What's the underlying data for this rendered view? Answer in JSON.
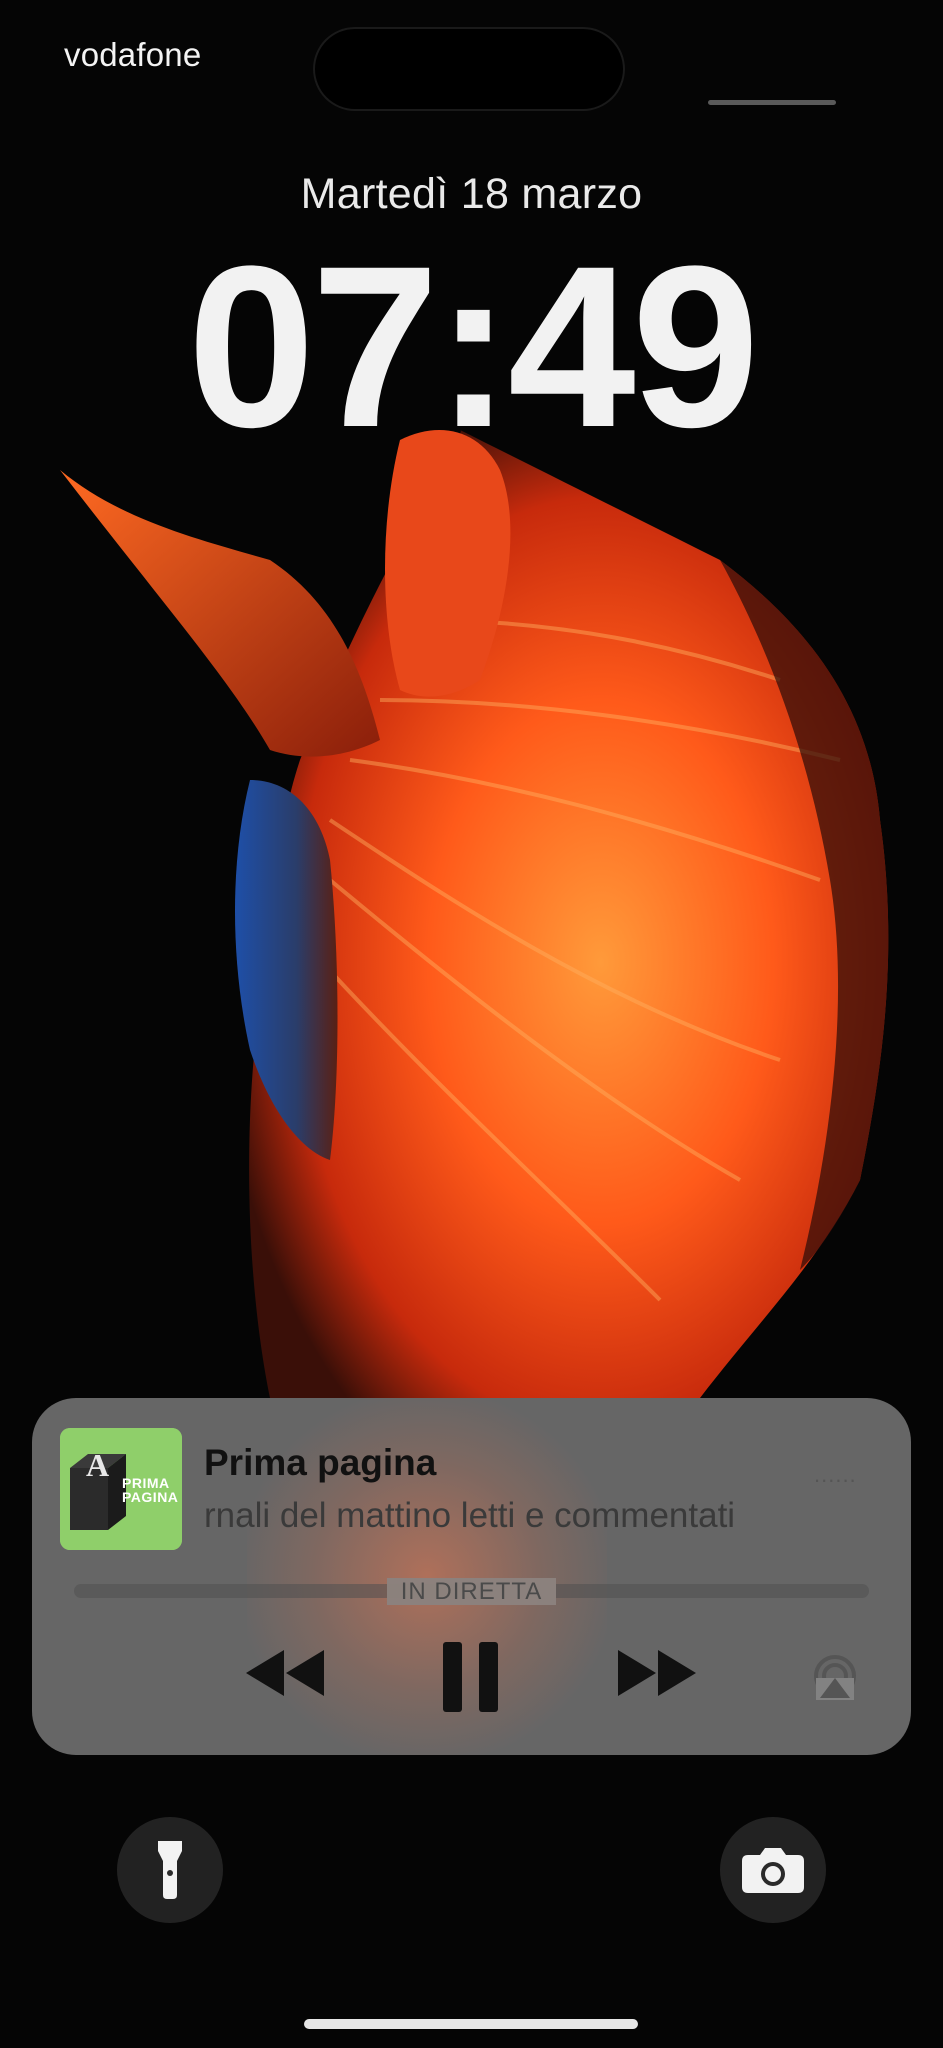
{
  "status_bar": {
    "carrier": "vodafone"
  },
  "lock_screen": {
    "date": "Martedì 18 marzo",
    "time": "07:49"
  },
  "now_playing": {
    "artwork": {
      "label": "PRIMA\nPAGINA",
      "background": "#8fcf6a"
    },
    "title": "Prima pagina",
    "subtitle": "rnali del mattino letti e commentati",
    "more_indicator": "......",
    "live_label": "IN DIRETTA",
    "controls": {
      "rewind_icon": "backward-icon",
      "pause_icon": "pause-icon",
      "forward_icon": "forward-icon",
      "airplay_icon": "airplay-icon"
    }
  },
  "quick_actions": {
    "left_icon": "flashlight-icon",
    "right_icon": "camera-icon"
  },
  "colors": {
    "background": "#050505",
    "fish_orange": "#ff4a14",
    "player_panel": "#828282",
    "text_light": "#f2f2f2"
  }
}
